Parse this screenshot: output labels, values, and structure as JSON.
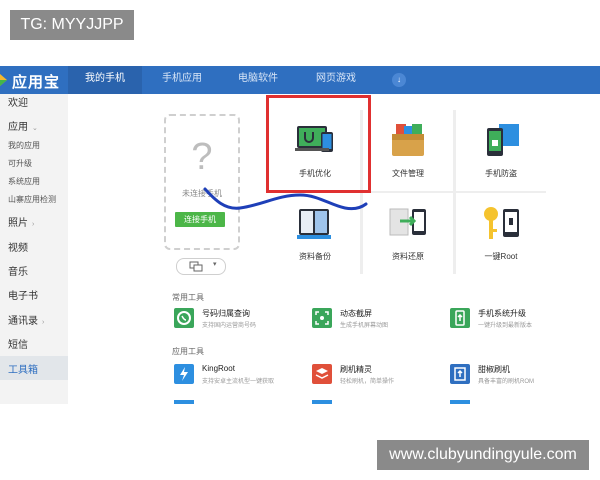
{
  "watermarks": {
    "top": "TG: MYYJJPP",
    "bottom": "www.clubyundingyule.com"
  },
  "app": {
    "logo_text": "应用宝",
    "tabs": [
      {
        "label": "我的手机",
        "active": true
      },
      {
        "label": "手机应用",
        "active": false
      },
      {
        "label": "电脑软件",
        "active": false
      },
      {
        "label": "网页游戏",
        "active": false
      }
    ],
    "sidebar": [
      {
        "label": "欢迎",
        "size": "big"
      },
      {
        "label": "应用",
        "size": "big",
        "arrow": "⌄"
      },
      {
        "label": "我的应用",
        "size": "small"
      },
      {
        "label": "可升级",
        "size": "small"
      },
      {
        "label": "系统应用",
        "size": "small"
      },
      {
        "label": "山寨应用检测",
        "size": "small"
      },
      {
        "label": "照片",
        "size": "big",
        "arrow": "›"
      },
      {
        "label": "视频",
        "size": "big"
      },
      {
        "label": "音乐",
        "size": "big"
      },
      {
        "label": "电子书",
        "size": "big"
      },
      {
        "label": "通讯录",
        "size": "big",
        "arrow": "›"
      },
      {
        "label": "短信",
        "size": "big"
      },
      {
        "label": "工具箱",
        "size": "big",
        "active": true
      }
    ],
    "device": {
      "status": "未连接手机",
      "connect_button": "连接手机"
    },
    "grid": [
      {
        "label": "手机优化",
        "icon": "phone-optimize-icon"
      },
      {
        "label": "文件管理",
        "icon": "file-manager-icon"
      },
      {
        "label": "手机防盗",
        "icon": "anti-theft-icon"
      },
      {
        "label": "资料备份",
        "icon": "data-backup-icon"
      },
      {
        "label": "资料还原",
        "icon": "data-restore-icon"
      },
      {
        "label": "一键Root",
        "icon": "one-key-root-icon"
      }
    ],
    "sections": {
      "common_tools": "常用工具",
      "app_tools": "应用工具"
    },
    "common_tools": [
      {
        "title": "号码归属查询",
        "desc": "支持国内运营商号码",
        "color": "#3aa65a"
      },
      {
        "title": "动态截屏",
        "desc": "生成手机屏幕动图",
        "color": "#3aa65a"
      },
      {
        "title": "手机系统升级",
        "desc": "一键升级到最新版本",
        "color": "#3aa65a"
      }
    ],
    "app_tools": [
      {
        "title": "KingRoot",
        "desc": "支持安卓主流机型一键获取",
        "color": "#2d8fe0"
      },
      {
        "title": "刷机精灵",
        "desc": "轻松刷机，简单操作",
        "color": "#e0503a"
      },
      {
        "title": "甜椒刷机",
        "desc": "具备丰富的刷机ROM",
        "color": "#2f6fc0"
      }
    ]
  }
}
